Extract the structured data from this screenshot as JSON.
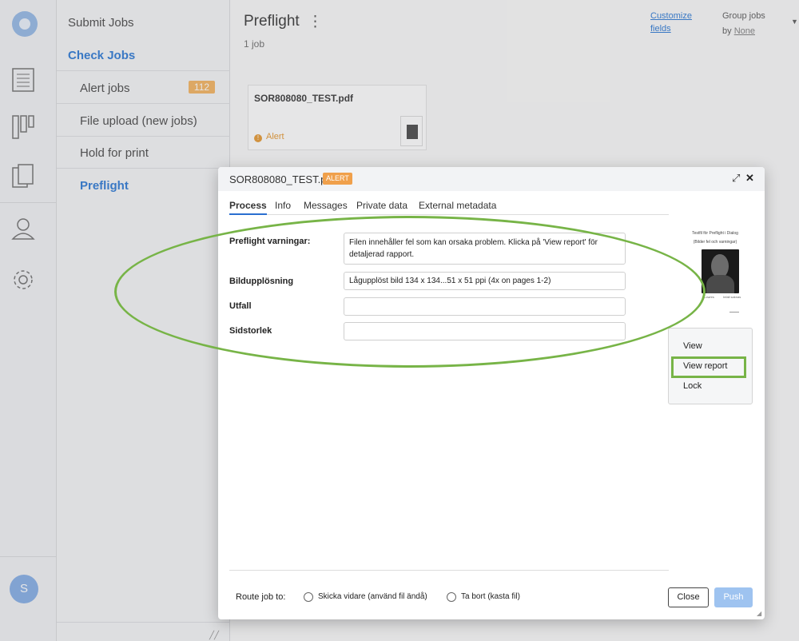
{
  "sidebar": {
    "submit_jobs": "Submit Jobs",
    "check_jobs": "Check Jobs",
    "items": [
      {
        "label": "Alert jobs",
        "badge": "112"
      },
      {
        "label": "File upload (new jobs)"
      },
      {
        "label": "Hold for print"
      },
      {
        "label": "Preflight"
      }
    ],
    "avatar_initial": "S"
  },
  "main": {
    "title": "Preflight",
    "kebab": "⋮",
    "job_count": "1 job",
    "customize_fields": "Customize fields",
    "group_jobs": "Group jobs",
    "group_by": "by",
    "group_value": "None",
    "card": {
      "name": "SOR808080_TEST.pdf",
      "status": "Alert"
    }
  },
  "modal": {
    "file_name": "SOR808080_TEST.pdf",
    "badge": "ALERT",
    "expand_icon": "⤢",
    "close_icon": "✕",
    "tabs": [
      "Process",
      "Info",
      "Messages",
      "Private data",
      "External metadata"
    ],
    "fields": [
      {
        "label": "Preflight varningar:",
        "value": "Filen innehåller fel som kan orsaka problem. Klicka på 'View report' för detaljerad rapport."
      },
      {
        "label": "Bildupplösning",
        "value": "Lågupplöst bild 134 x 134...51 x 51 ppi (4x on pages 1-2)"
      },
      {
        "label": "Utfall",
        "value": ""
      },
      {
        "label": "Sidstorlek",
        "value": ""
      }
    ],
    "preview": {
      "title": "Testfil för Preflight i Dialog",
      "subtitle": "(Bilder fel och varningar)",
      "caption_left": "Lowres",
      "caption_right": "Infall saknas"
    },
    "actions": [
      "View",
      "View report",
      "Lock"
    ],
    "route_label": "Route job to:",
    "route_options": [
      "Skicka vidare (använd fil ändå)",
      "Ta bort (kasta fil)"
    ],
    "close_button": "Close",
    "push_button": "Push"
  },
  "colors": {
    "accent": "#3b82d8",
    "highlight": "#77b447",
    "alert": "#f0a04b"
  }
}
